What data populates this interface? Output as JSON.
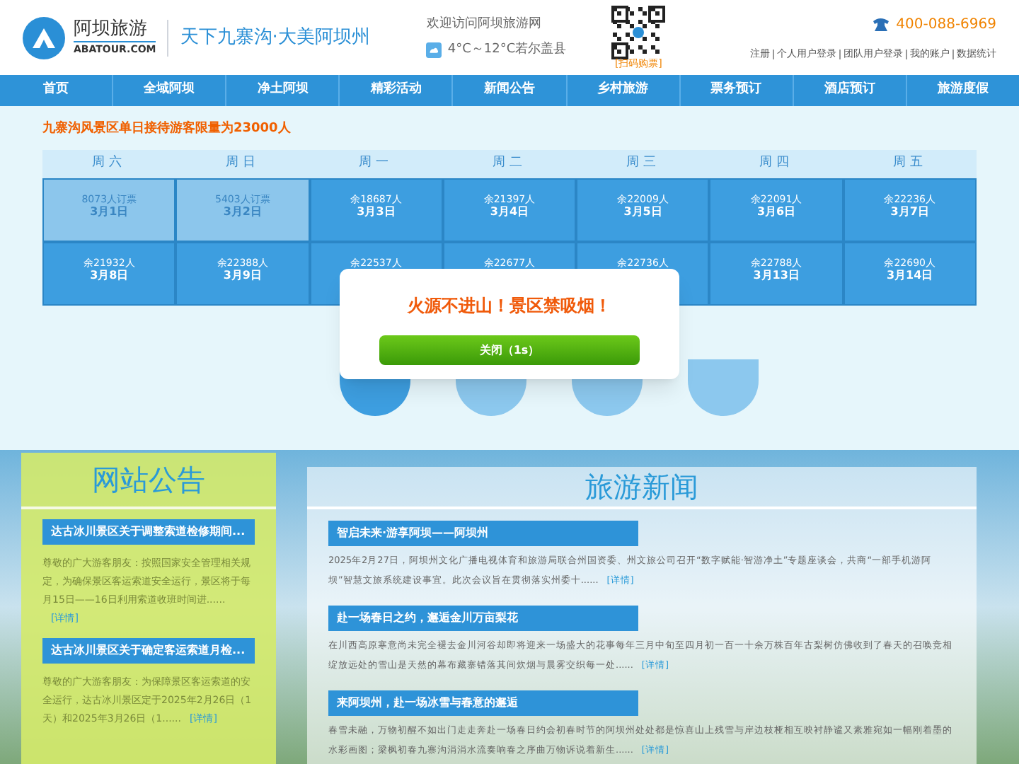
{
  "header": {
    "logo_name": "阿坝旅游",
    "logo_domain": "ABATOUR.COM",
    "slogan": "天下九寨沟·大美阿坝州",
    "welcome": "欢迎访问阿坝旅游网",
    "weather": "4°C～12°C若尔盖县",
    "qr_caption": "[扫码购票]",
    "phone": "400-088-6969",
    "user_links": [
      "注册",
      "个人用户登录",
      "团队用户登录",
      "我的账户",
      "数据统计"
    ]
  },
  "nav": [
    {
      "label": "首页"
    },
    {
      "label": "全域阿坝"
    },
    {
      "label": "净土阿坝"
    },
    {
      "label": "精彩活动"
    },
    {
      "label": "新闻公告"
    },
    {
      "label": "乡村旅游"
    },
    {
      "label": "票务预订"
    },
    {
      "label": "酒店预订"
    },
    {
      "label": "旅游度假"
    }
  ],
  "calendar": {
    "notice": "九寨沟风景区单日接待游客限量为23000人",
    "weekdays": [
      "周六",
      "周日",
      "周一",
      "周二",
      "周三",
      "周四",
      "周五"
    ],
    "days": [
      {
        "count": "8073人订票",
        "date": "3月1日",
        "past": true
      },
      {
        "count": "5403人订票",
        "date": "3月2日",
        "past": true
      },
      {
        "count": "余18687人",
        "date": "3月3日",
        "past": false
      },
      {
        "count": "余21397人",
        "date": "3月4日",
        "past": false
      },
      {
        "count": "余22009人",
        "date": "3月5日",
        "past": false
      },
      {
        "count": "余22091人",
        "date": "3月6日",
        "past": false
      },
      {
        "count": "余22236人",
        "date": "3月7日",
        "past": false
      },
      {
        "count": "余21932人",
        "date": "3月8日",
        "past": false
      },
      {
        "count": "余22388人",
        "date": "3月9日",
        "past": false
      },
      {
        "count": "余22537人",
        "past": false
      },
      {
        "count": "余22677人",
        "past": false
      },
      {
        "count": "余22736人",
        "past": false
      },
      {
        "count": "余22788人",
        "date": "3月13日",
        "past": false
      },
      {
        "count": "余22690人",
        "date": "3月14日",
        "past": false
      }
    ]
  },
  "scenic_tabs": [
    {
      "selected": true
    },
    {
      "selected": false
    },
    {
      "selected": false
    },
    {
      "selected": false
    }
  ],
  "popup": {
    "message": "火源不进山！景区禁吸烟！",
    "button": "关闭（1s）"
  },
  "announcements": {
    "title": "网站公告",
    "items": [
      {
        "title": "达古冰川景区关于调整索道检修期间...",
        "summary": "尊敬的广大游客朋友：按照国家安全管理相关规定，为确保景区客运索道安全运行，景区将于每月15日——16日利用索道收班时间进......",
        "link": "[详情]"
      },
      {
        "title": "达古冰川景区关于确定客运索道月检...",
        "summary": "尊敬的广大游客朋友：为保障景区客运索道的安全运行，达古冰川景区定于2025年2月26日（1天）和2025年3月26日（1......",
        "link": "[详情]"
      }
    ]
  },
  "news": {
    "title": "旅游新闻",
    "items": [
      {
        "title": "智启未来·游享阿坝——阿坝州",
        "summary": "2025年2月27日，阿坝州文化广播电视体育和旅游局联合州国资委、州文旅公司召开“数字赋能·智游净土”专题座谈会，共商“一部手机游阿坝”智慧文旅系统建设事宜。此次会议旨在贯彻落实州委十......",
        "link": "[详情]"
      },
      {
        "title": "赴一场春日之约，邂逅金川万亩梨花",
        "summary": "在川西高原寒意尚未完全褪去金川河谷却即将迎来一场盛大的花事每年三月中旬至四月初一百一十余万株百年古梨树仿佛收到了春天的召唤竞相绽放远处的雪山是天然的幕布藏寨错落其间炊烟与晨雾交织每一处......",
        "link": "[详情]"
      },
      {
        "title": "来阿坝州，赴一场冰雪与春意的邂逅",
        "summary": "春雪未融，万物初醒不如出门走走奔赴一场春日约会初春时节的阿坝州处处都是惊喜山上残雪与岸边枝桠相互映衬静谧又素雅宛如一幅刚着墨的水彩画图；梁枫初春九寨沟涓涓水流奏响春之序曲万物诉说着新生......",
        "link": "[详情]"
      }
    ]
  }
}
